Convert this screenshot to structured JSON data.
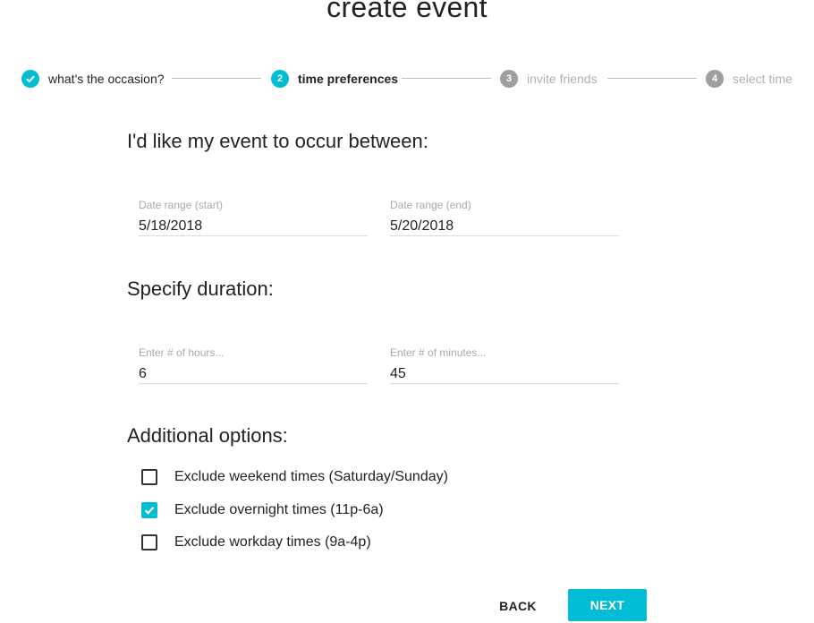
{
  "page": {
    "title": "create event"
  },
  "stepper": {
    "steps": [
      {
        "number": "",
        "label": "what's the occasion?",
        "state": "done"
      },
      {
        "number": "2",
        "label": "time preferences",
        "state": "active"
      },
      {
        "number": "3",
        "label": "invite friends",
        "state": "todo"
      },
      {
        "number": "4",
        "label": "select time",
        "state": "todo"
      }
    ]
  },
  "date_section": {
    "heading": "I'd like my event to occur between:",
    "start": {
      "label": "Date range (start)",
      "value": "5/18/2018"
    },
    "end": {
      "label": "Date range (end)",
      "value": "5/20/2018"
    }
  },
  "duration_section": {
    "heading": "Specify duration:",
    "hours": {
      "label": "Enter # of hours...",
      "value": "6"
    },
    "minutes": {
      "label": "Enter # of minutes...",
      "value": "45"
    }
  },
  "options_section": {
    "heading": "Additional options:",
    "options": [
      {
        "label": "Exclude weekend times (Saturday/Sunday)",
        "checked": false
      },
      {
        "label": "Exclude overnight times (11p-6a)",
        "checked": true
      },
      {
        "label": "Exclude workday times (9a-4p)",
        "checked": false
      }
    ]
  },
  "actions": {
    "back_label": "BACK",
    "next_label": "NEXT"
  },
  "colors": {
    "accent": "#00bcd4",
    "inactive_step": "#9e9e9e"
  }
}
